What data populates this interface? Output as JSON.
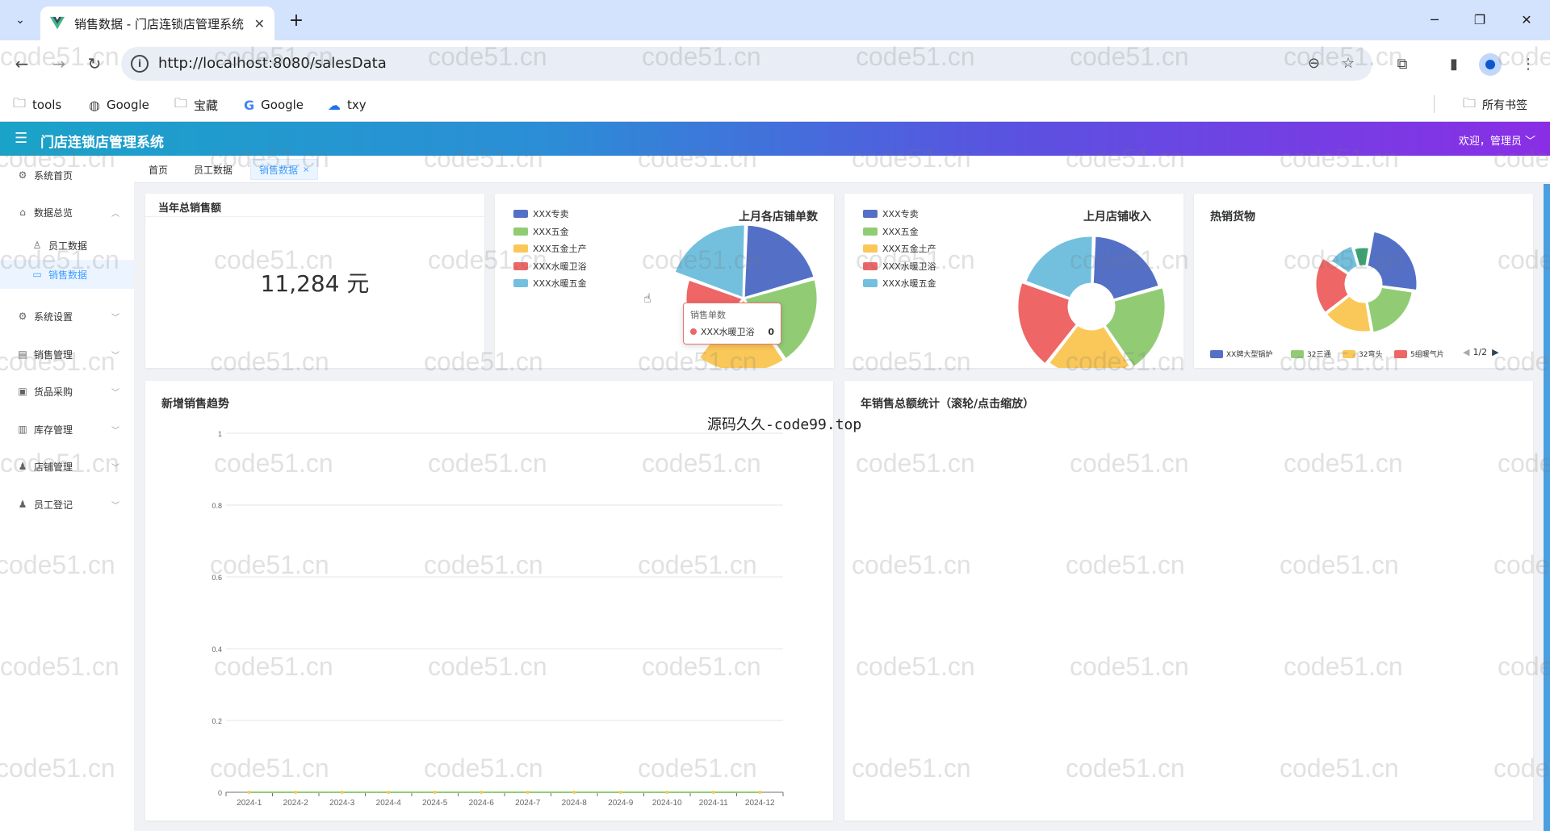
{
  "browser": {
    "tab_title": "销售数据 - 门店连锁店管理系统",
    "tab_close": "✕",
    "new_tab": "+",
    "url": "http://localhost:8080/salesData",
    "bookmarks": [
      {
        "label": "tools",
        "icon": "folder-icon"
      },
      {
        "label": "Google",
        "icon": "globe-icon"
      },
      {
        "label": "宝藏",
        "icon": "folder-icon"
      },
      {
        "label": "Google",
        "icon": "google-icon"
      },
      {
        "label": "txy",
        "icon": "cloud-icon"
      }
    ],
    "all_bookmarks": "所有书签"
  },
  "header": {
    "title": "门店连锁店管理系统",
    "user_menu": "欢迎，管理员 ﹀"
  },
  "sidebar": {
    "items": [
      {
        "label": "系统首页",
        "icon": "gear-icon"
      },
      {
        "label": "数据总览",
        "icon": "home-icon",
        "expanded": true
      },
      {
        "label": "员工数据",
        "icon": "user-icon"
      },
      {
        "label": "销售数据",
        "icon": "chart-icon",
        "active": true
      },
      {
        "label": "系统设置",
        "icon": "gear-icon"
      },
      {
        "label": "销售管理",
        "icon": "sales-icon"
      },
      {
        "label": "货品采购",
        "icon": "bag-icon"
      },
      {
        "label": "库存管理",
        "icon": "warehouse-icon"
      },
      {
        "label": "店铺管理",
        "icon": "store-icon"
      },
      {
        "label": "员工登记",
        "icon": "person-icon"
      }
    ]
  },
  "tags": [
    {
      "label": "首页"
    },
    {
      "label": "员工数据"
    },
    {
      "label": "销售数据",
      "active": true,
      "close": "×"
    }
  ],
  "cards": {
    "total_sales": {
      "title": "当年总销售额",
      "value": "11,284 元"
    },
    "order_count": {
      "title": "上月各店铺单数"
    },
    "store_income": {
      "title": "上月店铺收入"
    },
    "hot_goods": {
      "title": "热销货物",
      "pager": "1/2"
    },
    "trend": {
      "title": "新增销售趋势"
    },
    "annual": {
      "title": "年销售总额统计（滚轮/点击缩放）"
    }
  },
  "tooltip": {
    "title": "销售单数",
    "name": "XXX水暖卫浴",
    "value": "0"
  },
  "source_note": "源码久久-code99.top",
  "watermark": "code51.cn",
  "colors": {
    "blue": "#5470c6",
    "green": "#91cc75",
    "yellow": "#fac858",
    "red": "#ee6666",
    "cyan": "#73c0de",
    "teal": "#3ba272"
  },
  "chart_data": [
    {
      "type": "pie",
      "title": "上月各店铺单数",
      "categories": [
        "XXX专卖",
        "XXX五金",
        "XXX五金土产",
        "XXX水暖卫浴",
        "XXX水暖五金"
      ],
      "legend": "top-left"
    },
    {
      "type": "pie",
      "title": "上月店铺收入",
      "categories": [
        "XXX专卖",
        "XXX五金",
        "XXX五金土产",
        "XXX水暖卫浴",
        "XXX水暖五金"
      ],
      "legend": "top-left"
    },
    {
      "type": "pie",
      "title": "热销货物",
      "categories": [
        "XX牌大型锅炉",
        "32三通",
        "32弯头",
        "5组暖气片"
      ],
      "legend": "bottom"
    },
    {
      "type": "line",
      "title": "新增销售趋势",
      "categories": [
        "2024-1",
        "2024-2",
        "2024-3",
        "2024-4",
        "2024-5",
        "2024-6",
        "2024-7",
        "2024-8",
        "2024-9",
        "2024-10",
        "2024-11",
        "2024-12"
      ],
      "yticks": [
        "0",
        "0.2",
        "0.4",
        "0.6",
        "0.8",
        "1"
      ],
      "ylim": [
        0,
        1
      ],
      "series": [
        {
          "values": [
            0,
            0,
            0,
            0,
            0,
            0,
            0,
            0,
            0,
            0,
            0,
            0
          ]
        }
      ],
      "grid": true
    }
  ]
}
